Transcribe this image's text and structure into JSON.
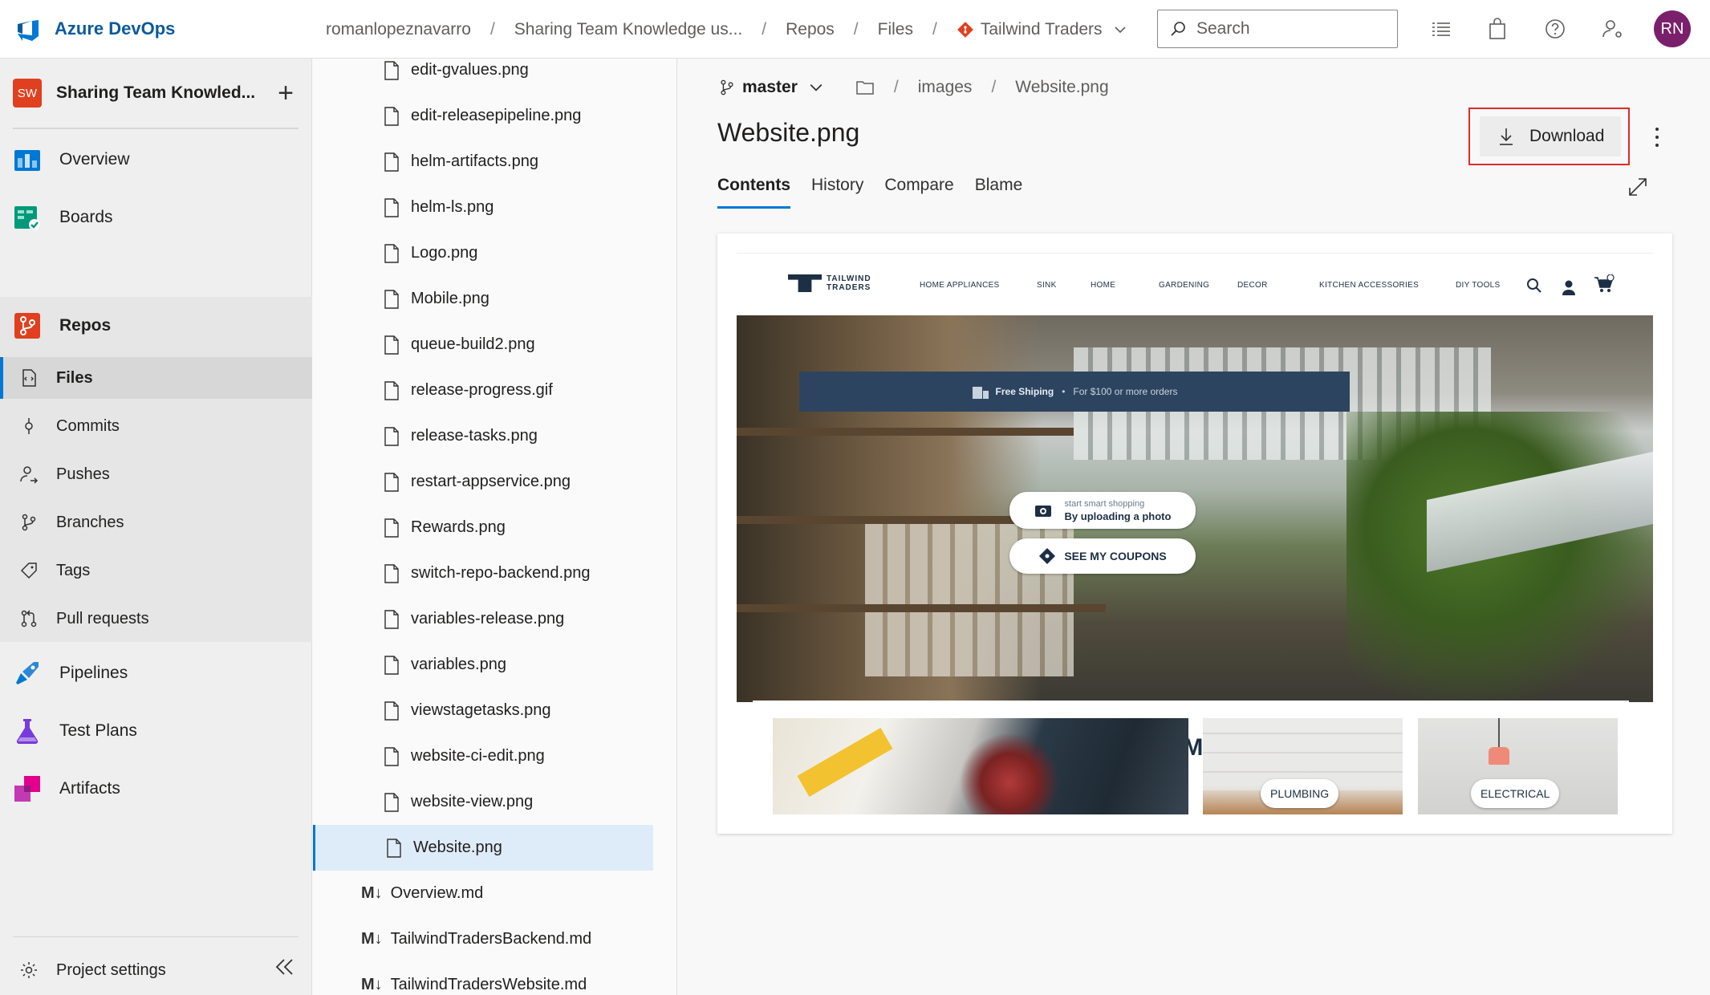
{
  "app": {
    "name": "Azure DevOps"
  },
  "breadcrumb": {
    "org": "romanlopeznavarro",
    "project": "Sharing Team Knowledge us...",
    "section": "Repos",
    "page": "Files",
    "repo": "Tailwind Traders"
  },
  "search": {
    "placeholder": "Search"
  },
  "user": {
    "initials": "RN"
  },
  "project": {
    "badge": "SW",
    "name": "Sharing Team Knowled..."
  },
  "nav": {
    "overview": "Overview",
    "boards": "Boards",
    "repos": "Repos",
    "files": "Files",
    "commits": "Commits",
    "pushes": "Pushes",
    "branches": "Branches",
    "tags": "Tags",
    "pull_requests": "Pull requests",
    "pipelines": "Pipelines",
    "test_plans": "Test Plans",
    "artifacts": "Artifacts",
    "project_settings": "Project settings"
  },
  "tree": {
    "files": [
      "edit-gvalues.png",
      "edit-releasepipeline.png",
      "helm-artifacts.png",
      "helm-ls.png",
      "Logo.png",
      "Mobile.png",
      "queue-build2.png",
      "release-progress.gif",
      "release-tasks.png",
      "restart-appservice.png",
      "Rewards.png",
      "switch-repo-backend.png",
      "variables-release.png",
      "variables.png",
      "viewstagetasks.png",
      "website-ci-edit.png",
      "website-view.png",
      "Website.png"
    ],
    "md_files": [
      "Overview.md",
      "TailwindTradersBackend.md",
      "TailwindTradersWebsite.md"
    ],
    "md_prefix": "M↓"
  },
  "main": {
    "branch": "master",
    "path_folder": "images",
    "path_file": "Website.png",
    "title": "Website.png",
    "download_label": "Download",
    "tabs": [
      "Contents",
      "History",
      "Compare",
      "Blame"
    ]
  },
  "preview": {
    "logo_line1": "TAILWIND",
    "logo_line2": "TRADERS",
    "menu": [
      "HOME APPLIANCES",
      "SINK",
      "HOME",
      "GARDENING",
      "DECOR",
      "KITCHEN ACCESSORIES",
      "DIY TOOLS"
    ],
    "shipping_title": "Free Shiping",
    "shipping_sub": "For $100 or more orders",
    "pill_small": "start smart shopping",
    "pill_upload": "By uploading a photo",
    "pill_coupons": "SEE MY COUPONS",
    "recommended": "RECOMMENDED",
    "tile_plumbing": "PLUMBING",
    "tile_electrical": "ELECTRICAL"
  },
  "colors": {
    "accent": "#0078d4",
    "highlight": "#e02b2b",
    "avatar": "#7a1f6c",
    "brand": "#0a5a9c"
  }
}
